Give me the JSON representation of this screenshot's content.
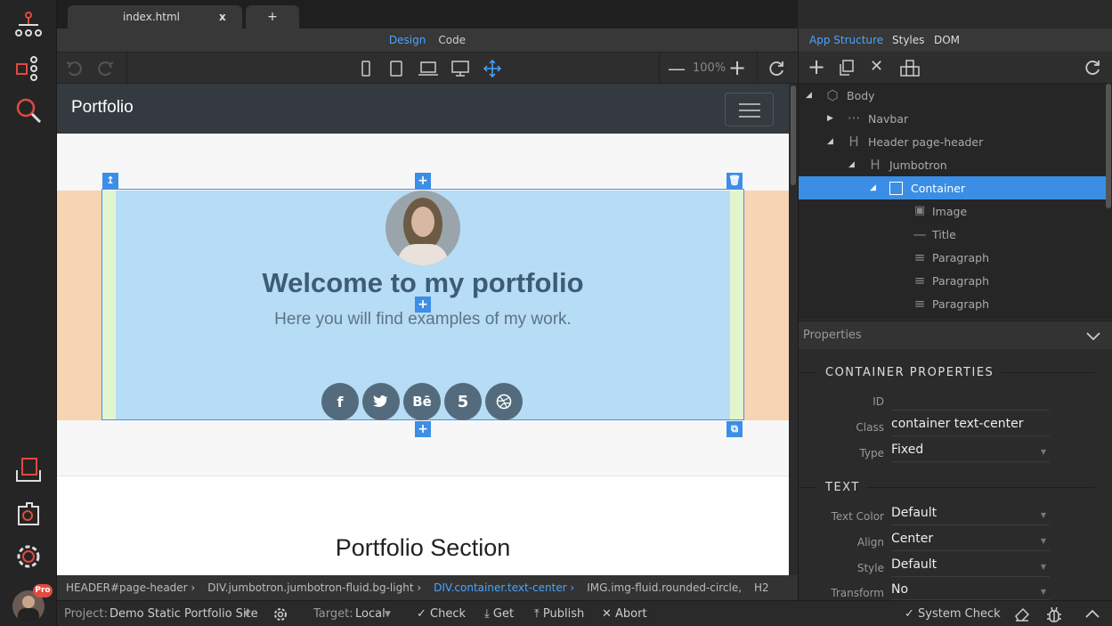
{
  "tabs": {
    "active": "index.html",
    "close": "x",
    "add": "+"
  },
  "view_modes": {
    "design": "Design",
    "code": "Code"
  },
  "toolbar": {
    "zoom": "100%"
  },
  "canvas": {
    "brand": "Portfolio",
    "jumbotron_title": "Welcome to my portfolio",
    "jumbotron_subtitle": "Here you will find examples of my work.",
    "behance_label": "Bē",
    "section_title": "Portfolio Section"
  },
  "breadcrumbs": [
    "HEADER#page-header ›",
    "DIV.jumbotron.jumbotron-fluid.bg-light ›",
    "DIV.container.text-center ›",
    "IMG.img-fluid.rounded-circle,",
    "H2"
  ],
  "status": {
    "project_label": "Project:",
    "project": "Demo Static Portfolio Site",
    "target_label": "Target:",
    "target": "Local",
    "check": "Check",
    "get": "Get",
    "publish": "Publish",
    "abort": "Abort",
    "system_check": "System Check",
    "badge": "Pro"
  },
  "right_tabs": {
    "app_structure": "App Structure",
    "styles": "Styles",
    "dom": "DOM"
  },
  "tree": [
    "Body",
    "Navbar",
    "Header page-header",
    "Jumbotron",
    "Container",
    "Image",
    "Title",
    "Paragraph",
    "Paragraph",
    "Paragraph"
  ],
  "props": {
    "header": "Properties",
    "section1": "CONTAINER PROPERTIES",
    "id_label": "ID",
    "id_value": "",
    "class_label": "Class",
    "class_value": "container text-center",
    "type_label": "Type",
    "type_value": "Fixed",
    "section2": "TEXT",
    "textcolor_label": "Text Color",
    "textcolor_value": "Default",
    "align_label": "Align",
    "align_value": "Center",
    "style_label": "Style",
    "style_value": "Default",
    "transform_label": "Transform",
    "transform_value": "No"
  },
  "colors": {
    "accent": "#3a8ee6",
    "link": "#4aa3ff",
    "logo_red": "#e04a3f"
  }
}
